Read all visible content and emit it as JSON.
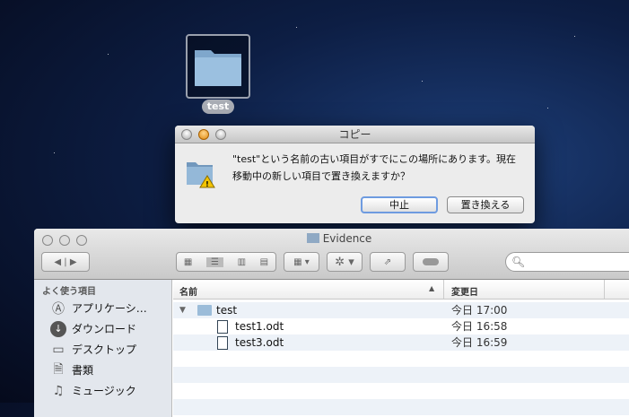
{
  "desktop": {
    "icon_label": "test"
  },
  "dialog": {
    "title": "コピー",
    "message_line1": "\"test\"という名前の古い項目がすでにこの場所にあります。現在",
    "message_line2": "移動中の新しい項目で置き換えますか？",
    "cancel_label": "中止",
    "replace_label": "置き換える"
  },
  "finder": {
    "title": "Evidence",
    "sidebar": {
      "header": "よく使う項目",
      "items": [
        {
          "label": "アプリケーシ…",
          "icon": "applications-icon"
        },
        {
          "label": "ダウンロード",
          "icon": "downloads-icon"
        },
        {
          "label": "デスクトップ",
          "icon": "desktop-icon"
        },
        {
          "label": "書類",
          "icon": "documents-icon"
        },
        {
          "label": "ミュージック",
          "icon": "music-icon"
        }
      ]
    },
    "columns": {
      "name": "名前",
      "modified": "変更日"
    },
    "rows": [
      {
        "name": "test",
        "date": "今日 17:00",
        "type": "folder"
      },
      {
        "name": "test1.odt",
        "date": "今日 16:58",
        "type": "document"
      },
      {
        "name": "test3.odt",
        "date": "今日 16:59",
        "type": "document"
      }
    ]
  }
}
